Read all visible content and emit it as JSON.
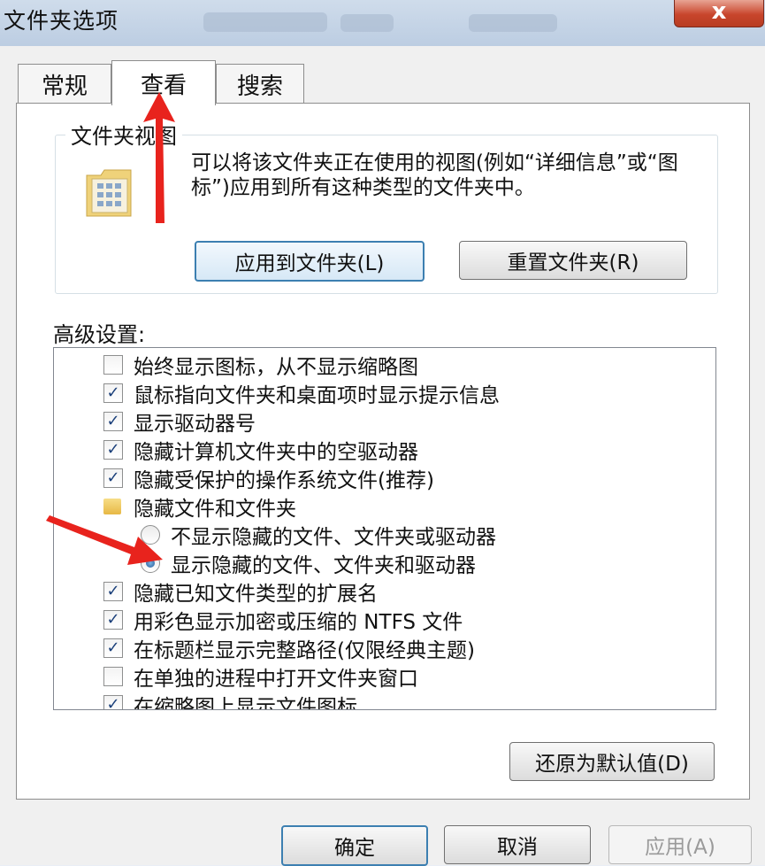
{
  "window": {
    "title": "文件夹选项",
    "close_label": "x"
  },
  "tabs": [
    {
      "label": "常规"
    },
    {
      "label": "查看"
    },
    {
      "label": "搜索"
    }
  ],
  "folder_view": {
    "group_label": "文件夹视图",
    "description": "可以将该文件夹正在使用的视图(例如“详细信息”或“图标”)应用到所有这种类型的文件夹中。",
    "apply_button": "应用到文件夹(L)",
    "reset_button": "重置文件夹(R)"
  },
  "advanced": {
    "label": "高级设置:",
    "items": [
      {
        "type": "checkbox",
        "checked": false,
        "label": "始终显示图标，从不显示缩略图"
      },
      {
        "type": "checkbox",
        "checked": true,
        "label": "鼠标指向文件夹和桌面项时显示提示信息"
      },
      {
        "type": "checkbox",
        "checked": true,
        "label": "显示驱动器号"
      },
      {
        "type": "checkbox",
        "checked": true,
        "label": "隐藏计算机文件夹中的空驱动器"
      },
      {
        "type": "checkbox",
        "checked": true,
        "label": "隐藏受保护的操作系统文件(推荐)"
      },
      {
        "type": "folder",
        "label": "隐藏文件和文件夹"
      },
      {
        "type": "radio",
        "checked": false,
        "label": "不显示隐藏的文件、文件夹或驱动器"
      },
      {
        "type": "radio",
        "checked": true,
        "label": "显示隐藏的文件、文件夹和驱动器"
      },
      {
        "type": "checkbox",
        "checked": true,
        "label": "隐藏已知文件类型的扩展名"
      },
      {
        "type": "checkbox",
        "checked": true,
        "label": "用彩色显示加密或压缩的 NTFS 文件"
      },
      {
        "type": "checkbox",
        "checked": true,
        "label": "在标题栏显示完整路径(仅限经典主题)"
      },
      {
        "type": "checkbox",
        "checked": false,
        "label": "在单独的进程中打开文件夹窗口"
      },
      {
        "type": "checkbox",
        "checked": true,
        "label": "在缩略图上显示文件图标"
      }
    ],
    "check_mark": "✓",
    "scroll_up": "▲",
    "scroll_down": "▼",
    "scroll_grip": "≡"
  },
  "restore_button": "还原为默认值(D)",
  "footer": {
    "ok": "确定",
    "cancel": "取消",
    "apply": "应用(A)"
  },
  "colors": {
    "arrow": "#e8231d",
    "accent": "#3c7fb1"
  }
}
